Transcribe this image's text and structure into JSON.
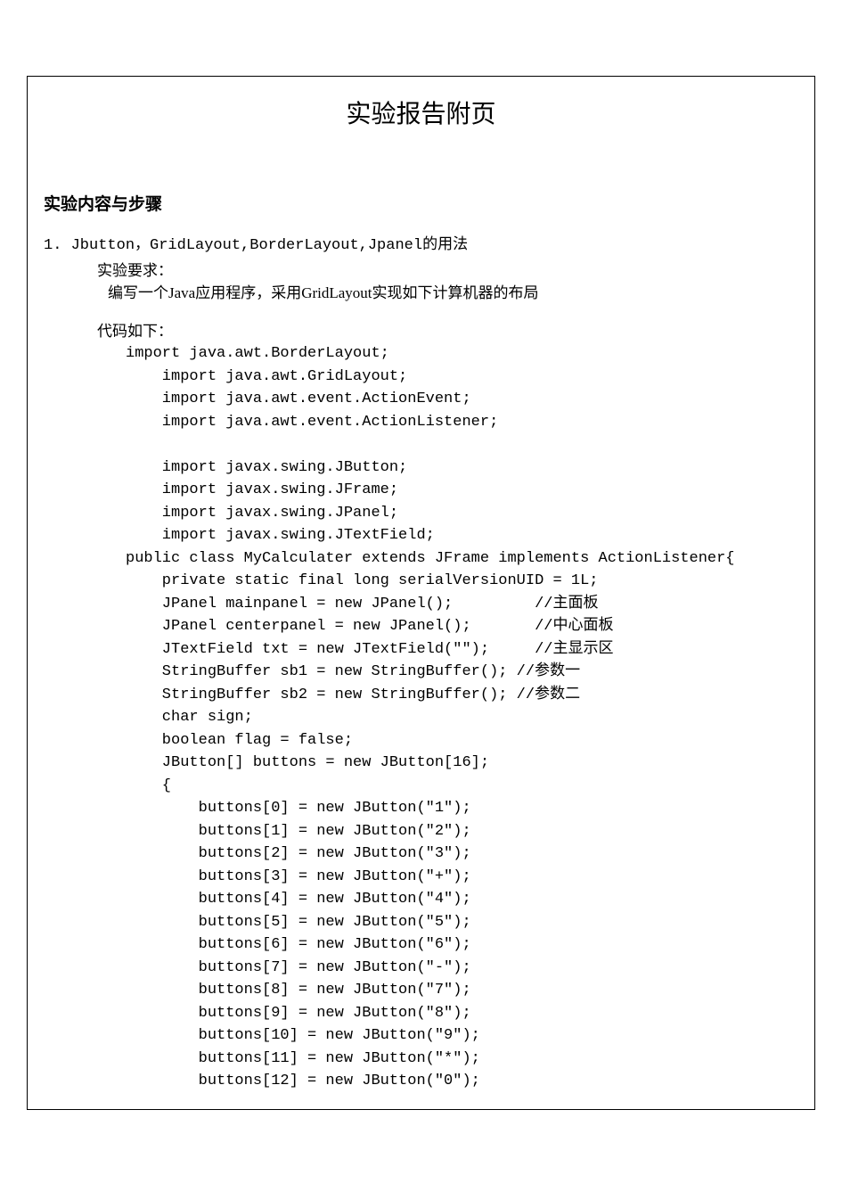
{
  "title": "实验报告附页",
  "section_heading": "实验内容与步骤",
  "item_number": "1.",
  "item_title": "Jbutton，GridLayout,BorderLayout,Jpanel的用法",
  "req_label": "实验要求：",
  "req_text": "编写一个Java应用程序，采用GridLayout实现如下计算机器的布局",
  "code_label": "代码如下：",
  "code_lines": [
    "import java.awt.BorderLayout;",
    "    import java.awt.GridLayout;",
    "    import java.awt.event.ActionEvent;",
    "    import java.awt.event.ActionListener;",
    "",
    "    import javax.swing.JButton;",
    "    import javax.swing.JFrame;",
    "    import javax.swing.JPanel;",
    "    import javax.swing.JTextField;",
    "public class MyCalculater extends JFrame implements ActionListener{",
    "    private static final long serialVersionUID = 1L;",
    "    JPanel mainpanel = new JPanel();         //主面板",
    "    JPanel centerpanel = new JPanel();       //中心面板",
    "    JTextField txt = new JTextField(\"\");     //主显示区",
    "    StringBuffer sb1 = new StringBuffer(); //参数一",
    "    StringBuffer sb2 = new StringBuffer(); //参数二",
    "    char sign;",
    "    boolean flag = false;",
    "    JButton[] buttons = new JButton[16];",
    "    {",
    "        buttons[0] = new JButton(\"1\");",
    "        buttons[1] = new JButton(\"2\");",
    "        buttons[2] = new JButton(\"3\");",
    "        buttons[3] = new JButton(\"+\");",
    "        buttons[4] = new JButton(\"4\");",
    "        buttons[5] = new JButton(\"5\");",
    "        buttons[6] = new JButton(\"6\");",
    "        buttons[7] = new JButton(\"-\");",
    "        buttons[8] = new JButton(\"7\");",
    "        buttons[9] = new JButton(\"8\");",
    "        buttons[10] = new JButton(\"9\");",
    "        buttons[11] = new JButton(\"*\");",
    "        buttons[12] = new JButton(\"0\");"
  ]
}
